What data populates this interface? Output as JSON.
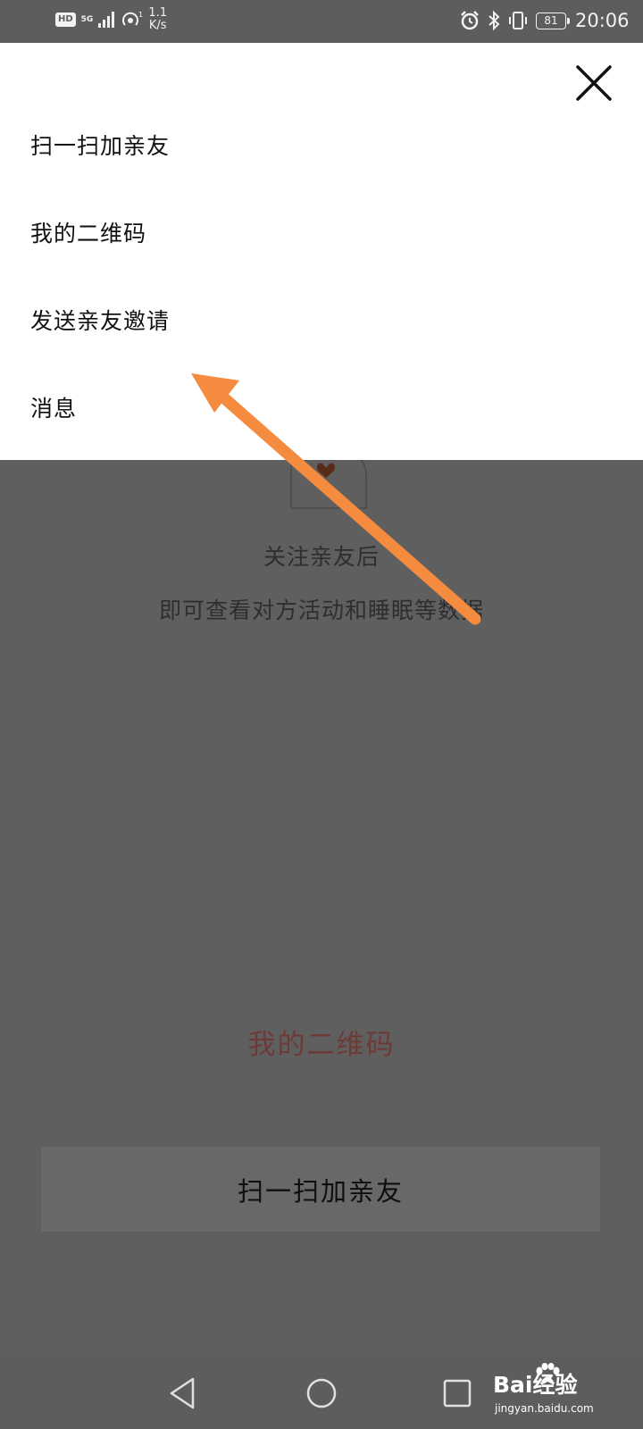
{
  "status_bar": {
    "hd": "HD",
    "network": "5G",
    "speed_value": "1.1",
    "speed_unit": "K/s",
    "battery": "81",
    "time": "20:06"
  },
  "menu": {
    "items": [
      "扫一扫加亲友",
      "我的二维码",
      "发送亲友邀请",
      "消息"
    ]
  },
  "background": {
    "line1": "关注亲友后",
    "line2": "即可查看对方活动和睡眠等数据",
    "qr_link": "我的二维码",
    "scan_button": "扫一扫加亲友"
  },
  "watermark": {
    "brand": "Bai经验",
    "url": "jingyan.baidu.com"
  },
  "colors": {
    "overlay": "#5f5f60",
    "annotation_arrow": "#f48b3e",
    "qr_link": "#6e3a36"
  }
}
